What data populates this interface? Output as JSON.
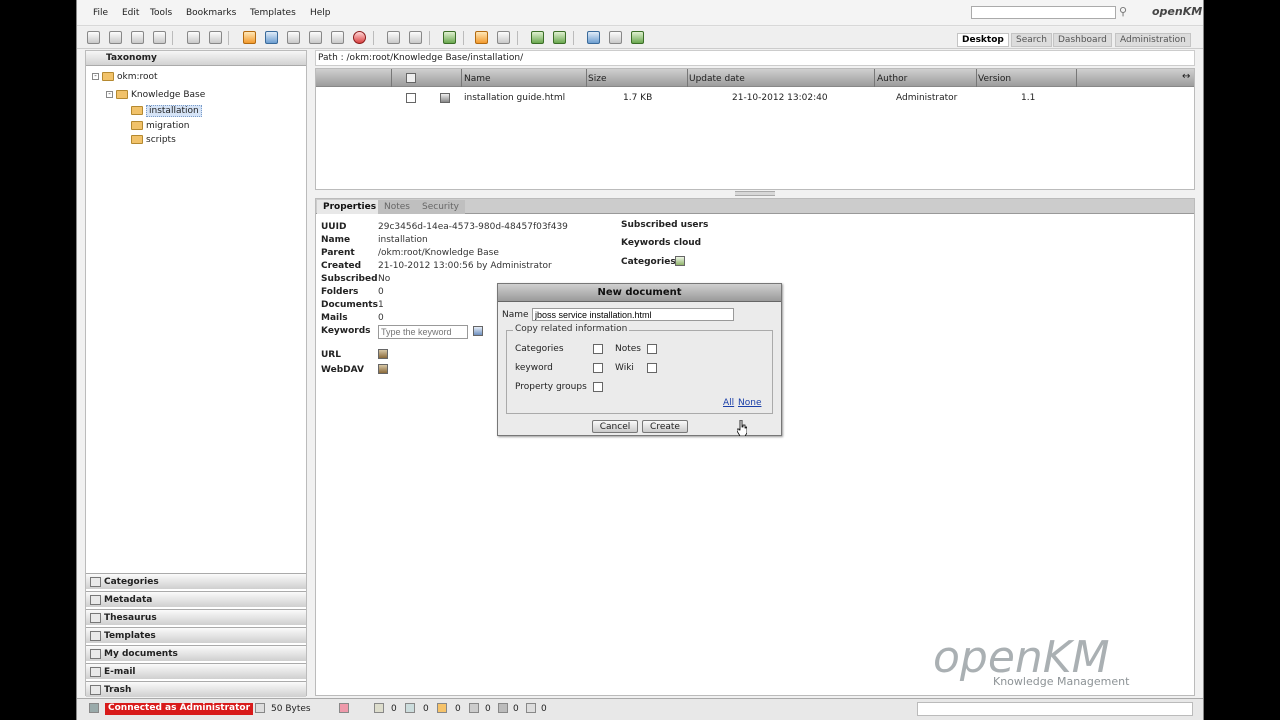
{
  "menu": [
    "File",
    "Edit",
    "Tools",
    "Bookmarks",
    "Templates",
    "Help"
  ],
  "logo_small": "openKM",
  "views": {
    "desktop": "Desktop",
    "search": "Search",
    "dashboard": "Dashboard",
    "administration": "Administration"
  },
  "taxonomy": {
    "header": "Taxonomy",
    "root": "okm:root",
    "kb": "Knowledge Base",
    "children": [
      "installation",
      "migration",
      "scripts"
    ]
  },
  "stack": [
    "Categories",
    "Metadata",
    "Thesaurus",
    "Templates",
    "My documents",
    "E-mail",
    "Trash"
  ],
  "path": "Path : /okm:root/Knowledge Base/installation/",
  "grid": {
    "headers": {
      "name": "Name",
      "size": "Size",
      "date": "Update date",
      "author": "Author",
      "version": "Version"
    },
    "rows": [
      {
        "name": "installation guide.html",
        "size": "1.7 KB",
        "date": "21-10-2012 13:02:40",
        "author": "Administrator",
        "version": "1.1"
      }
    ]
  },
  "tabs": [
    "Properties",
    "Notes",
    "Security"
  ],
  "properties": {
    "uuid_l": "UUID",
    "uuid": "29c3456d-14ea-4573-980d-48457f03f439",
    "name_l": "Name",
    "name": "installation",
    "parent_l": "Parent",
    "parent": "/okm:root/Knowledge Base",
    "created_l": "Created",
    "created": "21-10-2012 13:00:56 by Administrator",
    "subscribed_l": "Subscribed",
    "subscribed": "No",
    "folders_l": "Folders",
    "folders": "0",
    "documents_l": "Documents",
    "documents": "1",
    "mails_l": "Mails",
    "mails": "0",
    "keywords_l": "Keywords",
    "keywords_placeholder": "Type the keyword",
    "url_l": "URL",
    "webdav_l": "WebDAV",
    "subscribed_users": "Subscribed users",
    "keywords_cloud": "Keywords cloud",
    "categories": "Categories"
  },
  "dialog": {
    "title": "New document",
    "name_label": "Name",
    "name_value": "jboss service installation.html",
    "legend": "Copy related information",
    "categories": "Categories",
    "notes": "Notes",
    "keyword": "keyword",
    "wiki": "Wiki",
    "property_groups": "Property groups",
    "all": "All",
    "none": "None",
    "cancel": "Cancel",
    "create": "Create"
  },
  "watermark": {
    "brand": "openKM",
    "tagline": "Knowledge Management"
  },
  "status": {
    "connected": "Connected as Administrator",
    "size": "50 Bytes",
    "counts": [
      "0",
      "0",
      "0",
      "0",
      "0",
      "0"
    ]
  }
}
